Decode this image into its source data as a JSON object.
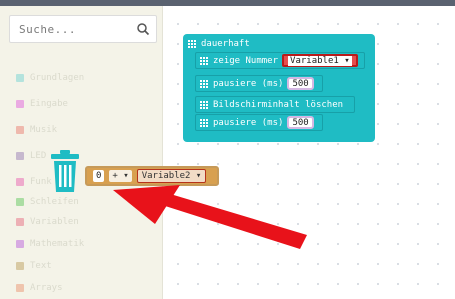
{
  "toolbox": {
    "search_placeholder": "Suche...",
    "categories": [
      {
        "label": "Grundlagen",
        "color": "#1fbcc4"
      },
      {
        "label": "Eingabe",
        "color": "#d400d4"
      },
      {
        "label": "Musik",
        "color": "#e63022"
      },
      {
        "label": "LED",
        "color": "#5c2d91"
      },
      {
        "label": "Funk",
        "color": "#e3008c"
      },
      {
        "label": "Schleifen",
        "color": "#00aa00"
      },
      {
        "label": "Variablen",
        "color": "#dc143c"
      },
      {
        "label": "Mathematik",
        "color": "#9400d3"
      },
      {
        "label": "Text",
        "color": "#996600"
      },
      {
        "label": "Arrays",
        "color": "#e65722"
      }
    ]
  },
  "workspace": {
    "forever_block": {
      "label": "dauerhaft",
      "statements": [
        {
          "label": "zeige Nummer",
          "slot": "Variable1 ▾"
        },
        {
          "label": "pausiere (ms)",
          "slot": "500"
        },
        {
          "label": "Bildschirminhalt löschen"
        },
        {
          "label": "pausiere (ms)",
          "slot": "500"
        }
      ]
    },
    "dragged_block": {
      "left_value": "0",
      "operator": "+ ▾",
      "right_value": "Variable2 ▾"
    }
  },
  "colors": {
    "basic_block": "#1fbcc4",
    "math_block": "#d8a050",
    "variable_block": "#e74d4d",
    "trash": "#1fbcc4",
    "arrow": "#e8121a"
  }
}
